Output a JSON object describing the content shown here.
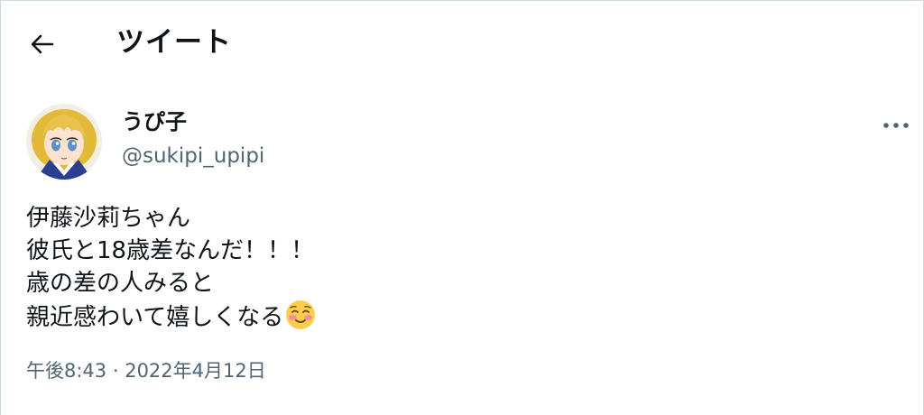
{
  "header": {
    "back_icon": "arrow-left-icon",
    "title": "ツイート"
  },
  "author": {
    "display_name": "うぴ子",
    "username": "@sukipi_upipi",
    "avatar_icon": "anime-girl-avatar"
  },
  "more_icon": "more-horizontal-icon",
  "tweet": {
    "lines": [
      "伊藤沙莉ちゃん",
      "彼氏と18歳差なんだ！！！",
      "歳の差の人みると",
      "親近感わいて嬉しくなる"
    ],
    "emoji": "smiling-face-with-blush-emoji"
  },
  "meta": {
    "time": "午後8:43",
    "separator": " · ",
    "date": "2022年4月12日"
  },
  "colors": {
    "text": "#0f1419",
    "secondary": "#536471",
    "border": "#cfd9de"
  }
}
